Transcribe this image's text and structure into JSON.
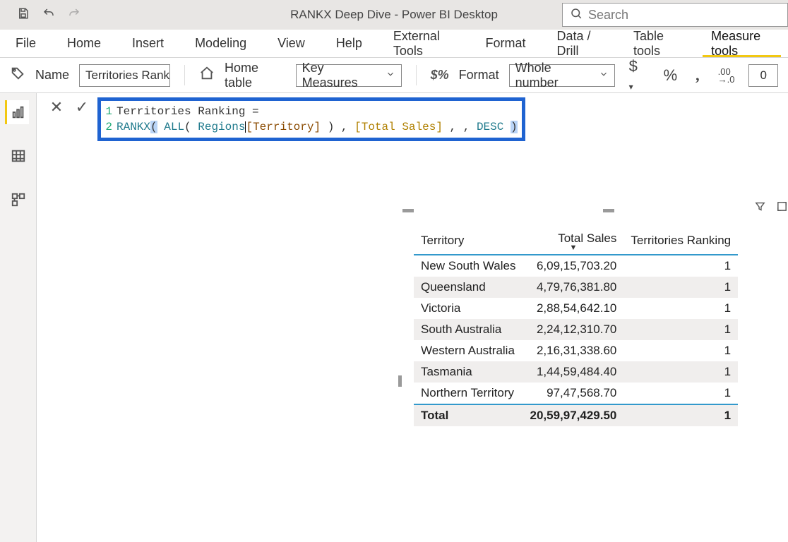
{
  "titlebar": {
    "app_title": "RANKX Deep Dive - Power BI Desktop",
    "search_placeholder": "Search"
  },
  "tabs": {
    "file": "File",
    "home": "Home",
    "insert": "Insert",
    "modeling": "Modeling",
    "view": "View",
    "help": "Help",
    "external": "External Tools",
    "format": "Format",
    "datadrill": "Data / Drill",
    "tabletools": "Table tools",
    "measuretools": "Measure tools",
    "active": "measuretools"
  },
  "ribbon": {
    "name_label": "Name",
    "name_value": "Territories Rank...",
    "home_table_label": "Home table",
    "home_table_value": "Key Measures",
    "format_label": "Format",
    "format_value": "Whole number",
    "currency_symbol": "$",
    "percent_symbol": "%",
    "thousands_symbol": ",",
    "precision_icon": ".00\n→.0",
    "decimals_value": "0"
  },
  "formula": {
    "line1_num": "1",
    "line2_num": "2",
    "line1_text": "Territories Ranking =",
    "rankx": "RANKX",
    "all": "ALL",
    "regions": "Regions",
    "territory_col": "[Territory]",
    "total_sales": "[Total Sales]",
    "desc": "DESC"
  },
  "table": {
    "headers": {
      "territory": "Territory",
      "total_sales": "Total Sales",
      "rank": "Territories Ranking"
    },
    "rows": [
      {
        "territory": "New South Wales",
        "total_sales": "6,09,15,703.20",
        "rank": "1"
      },
      {
        "territory": "Queensland",
        "total_sales": "4,79,76,381.80",
        "rank": "1"
      },
      {
        "territory": "Victoria",
        "total_sales": "2,88,54,642.10",
        "rank": "1"
      },
      {
        "territory": "South Australia",
        "total_sales": "2,24,12,310.70",
        "rank": "1"
      },
      {
        "territory": "Western Australia",
        "total_sales": "2,16,31,338.60",
        "rank": "1"
      },
      {
        "territory": "Tasmania",
        "total_sales": "1,44,59,484.40",
        "rank": "1"
      },
      {
        "territory": "Northern Territory",
        "total_sales": "97,47,568.70",
        "rank": "1"
      }
    ],
    "total": {
      "label": "Total",
      "total_sales": "20,59,97,429.50",
      "rank": "1"
    }
  },
  "chart_data": {
    "type": "table",
    "title": "",
    "columns": [
      "Territory",
      "Total Sales",
      "Territories Ranking"
    ],
    "rows": [
      [
        "New South Wales",
        60915703.2,
        1
      ],
      [
        "Queensland",
        47976381.8,
        1
      ],
      [
        "Victoria",
        28854642.1,
        1
      ],
      [
        "South Australia",
        22412310.7,
        1
      ],
      [
        "Western Australia",
        21631338.6,
        1
      ],
      [
        "Tasmania",
        14459484.4,
        1
      ],
      [
        "Northern Territory",
        9747568.7,
        1
      ]
    ],
    "total": [
      "Total",
      205997429.5,
      1
    ],
    "sort": {
      "column": "Total Sales",
      "direction": "desc"
    }
  }
}
